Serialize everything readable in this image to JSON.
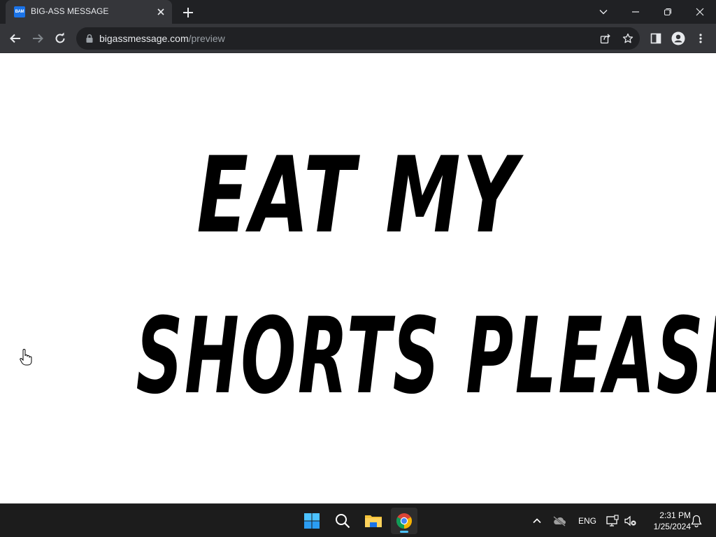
{
  "browser": {
    "tab": {
      "favicon_text": "BAM",
      "title": "BIG-ASS MESSAGE"
    },
    "address_bar": {
      "host": "bigassmessage.com",
      "path": "/preview"
    }
  },
  "page": {
    "message_line1": "EAT MY",
    "message_line2": "SHORTS PLEASE"
  },
  "taskbar": {
    "apps": [
      "start-icon",
      "search-icon",
      "file-explorer-icon",
      "chrome-icon"
    ],
    "active_app": "chrome-icon",
    "language": "ENG",
    "time": "2:31 PM",
    "date": "1/25/2024"
  },
  "colors": {
    "titlebar": "#202124",
    "toolbar": "#35363a",
    "page_background": "#ffffff",
    "message_text": "#000000",
    "taskbar": "#1c1c1c",
    "accent": "#4cc2ff"
  }
}
